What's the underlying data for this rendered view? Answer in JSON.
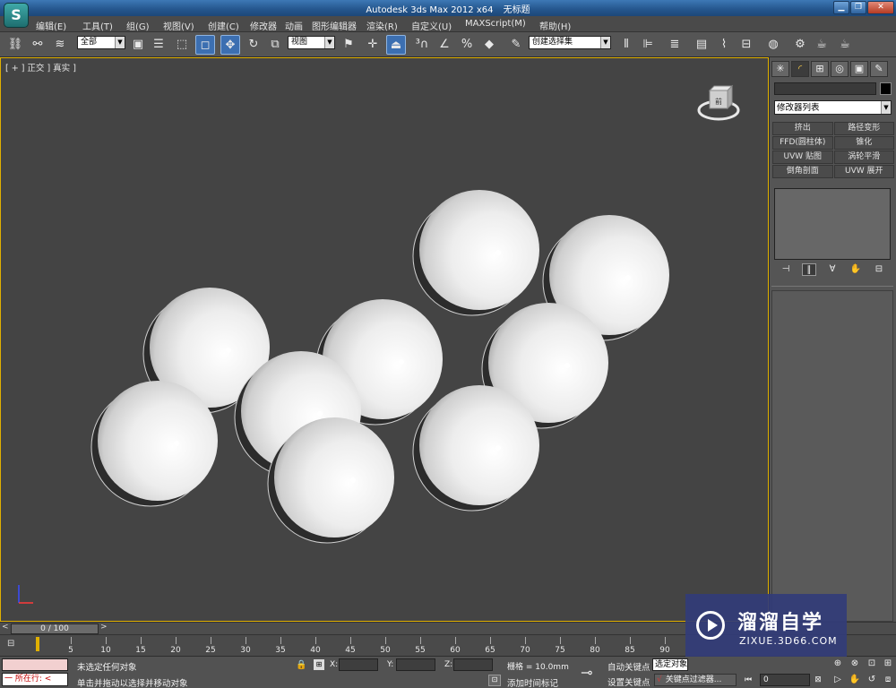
{
  "titlebar": {
    "app_title": "Autodesk 3ds Max  2012 x64",
    "doc_title": "无标题",
    "logo_glyph": "S",
    "minimize": "▁",
    "restore": "❐",
    "close": "✕"
  },
  "menu": [
    "编辑(E)",
    "工具(T)",
    "组(G)",
    "视图(V)",
    "创建(C)",
    "修改器",
    "动画",
    "图形编辑器",
    "渲染(R)",
    "自定义(U)",
    "MAXScript(M)",
    "帮助(H)"
  ],
  "toolbar": {
    "selection_filter": "全部",
    "ref_coord": "视图",
    "named_selection": "创建选择集",
    "icons": [
      "link-icon",
      "unlink-icon",
      "bind-spacewarp-icon",
      "select-object-icon",
      "select-by-name-icon",
      "rect-region-icon",
      "window-crossing-icon",
      "select-move-icon",
      "select-rotate-icon",
      "select-scale-icon",
      "select-manipulate-icon",
      "keyboard-shortcut-icon",
      "snaps-3d-icon",
      "angle-snap-icon",
      "percent-snap-icon",
      "spinner-snap-icon",
      "edit-named-sel-icon",
      "mirror-icon",
      "align-icon",
      "layer-manager-icon",
      "graphite-icon",
      "curve-editor-icon",
      "schematic-view-icon",
      "material-editor-icon",
      "render-setup-icon",
      "rendered-frame-icon",
      "render-icon"
    ]
  },
  "viewport": {
    "label": "[ + ] 正交 ] 真实 ]",
    "viewcube_label": "前",
    "sphere_color": "#f0f0f0",
    "background": "#444444"
  },
  "command_panel": {
    "tabs": [
      "✳",
      "◜",
      "⊞",
      "◎",
      "▣",
      "✎"
    ],
    "modifier_list": "修改器列表",
    "modifier_buttons": [
      "挤出",
      "路径变形",
      "FFD(圆柱体)",
      "锥化",
      "UVW 贴图",
      "涡轮平滑",
      "倒角剖面",
      "UVW 展开"
    ],
    "stack_tools": [
      "⊣",
      "∥",
      "∀",
      "✋",
      "⊟"
    ]
  },
  "timeline": {
    "frame_display": "0 / 100",
    "prev": "<",
    "next": ">",
    "ticks": [
      "5",
      "10",
      "15",
      "20",
      "25",
      "30",
      "35",
      "40",
      "45",
      "50",
      "55",
      "60",
      "65",
      "70",
      "75",
      "80",
      "85",
      "90"
    ]
  },
  "status": {
    "maxscript_prompt": "一 所在行: <",
    "selection_msg": "未选定任何对象",
    "hint_msg": "单击并拖动以选择并移动对象",
    "x_label": "X:",
    "y_label": "Y:",
    "z_label": "Z:",
    "grid": "栅格 = 10.0mm",
    "add_time_tag": "添加时间标记",
    "auto_key": "自动关键点",
    "set_key": "设置关键点",
    "selected_set": "选定对象",
    "key_filters": "关键点过滤器...",
    "current_frame": "0"
  },
  "watermark": {
    "title": "溜溜自学",
    "subtitle": "ZIXUE.3D66.COM"
  }
}
